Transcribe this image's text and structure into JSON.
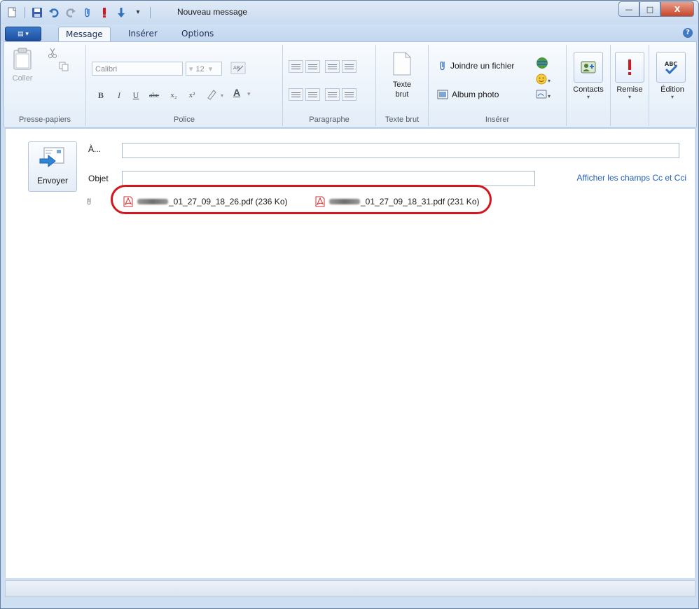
{
  "window": {
    "title": "Nouveau message"
  },
  "quick_access": [
    "new-icon",
    "save-icon",
    "undo-icon",
    "redo-icon",
    "attach-icon",
    "priority-icon",
    "low-priority-icon",
    "customize-icon"
  ],
  "tabs": [
    {
      "label": "Message",
      "active": true
    },
    {
      "label": "Insérer",
      "active": false
    },
    {
      "label": "Options",
      "active": false
    }
  ],
  "ribbon": {
    "clipboard": {
      "paste_label": "Coller",
      "group_label": "Presse-papiers"
    },
    "font": {
      "font_name": "Calibri",
      "font_size": "12",
      "group_label": "Police",
      "bold": "B",
      "italic": "I",
      "underline": "U",
      "strike": "abc",
      "subscript": "x₂",
      "superscript": "x²",
      "color": "A"
    },
    "paragraph": {
      "group_label": "Paragraphe"
    },
    "plain_text": {
      "label_line1": "Texte",
      "label_line2": "brut",
      "group_label": "Texte brut"
    },
    "insert": {
      "attach_label": "Joindre un fichier",
      "album_label": "Album photo",
      "group_label": "Insérer"
    },
    "contacts_label": "Contacts",
    "remise_label": "Remise",
    "edition_label": "Édition"
  },
  "header": {
    "send_label": "Envoyer",
    "to_label": "À...",
    "to_value": "",
    "subject_label": "Objet",
    "subject_value": "",
    "cc_link": "Afficher les champs Cc et Cci",
    "attachments": [
      {
        "name": "_01_27_09_18_26.pdf (236 Ko)"
      },
      {
        "name": "_01_27_09_18_31.pdf (231 Ko)"
      }
    ]
  },
  "colors": {
    "accent": "#2360b5",
    "highlight": "#d4161f",
    "frame": "#cfdff2"
  }
}
